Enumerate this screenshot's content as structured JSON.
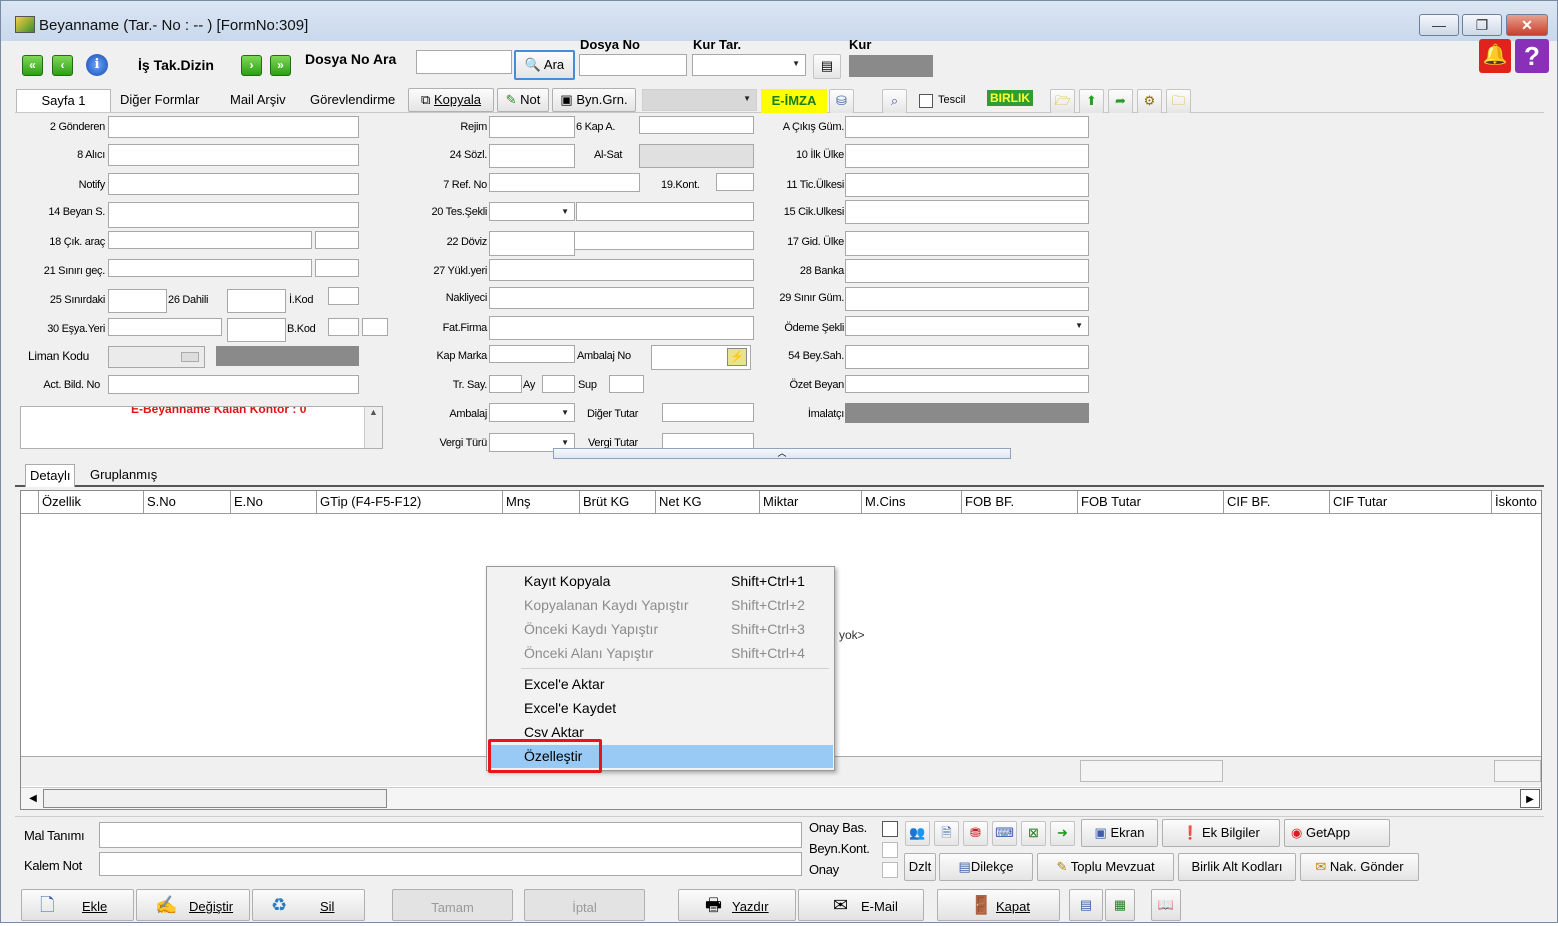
{
  "window": {
    "title": "Beyanname (Tar.- No : --  )  [FormNo:309]",
    "minimize": "—",
    "restore": "❐",
    "close": "✕"
  },
  "toolbar": {
    "first": "«",
    "prev": "‹",
    "info": "i",
    "next": "›",
    "last": "»",
    "task_dir": "İş Tak.Dizin",
    "file_search_label": "Dosya No Ara",
    "search_button": "Ara",
    "file_no_label": "Dosya No",
    "rate_date_label": "Kur Tar.",
    "rate_label": "Kur",
    "bell_icon": "bell-icon",
    "help_icon": "?"
  },
  "tabs": {
    "page1": "Sayfa 1",
    "other_forms": "Diğer Formlar",
    "mail_archive": "Mail Arşiv",
    "assignment": "Görevlendirme",
    "copy": "Kopyala",
    "note": "Not",
    "byn": "Byn.Grn.",
    "eimza": "E-İMZA",
    "tescil": "Tescil",
    "birlik": "BIRLIK"
  },
  "fields": {
    "col1": [
      "2 Gönderen",
      "8 Alıcı",
      "Notify",
      "14 Beyan S.",
      "18 Çık. araç",
      "21 Sınırı geç.",
      "25 Sınırdaki",
      "26 Dahili",
      "İ.Kod",
      "30 Eşya.Yeri",
      "B.Kod",
      "Liman Kodu",
      "Act. Bild. No"
    ],
    "col2": [
      "Rejim",
      "6 Kap A.",
      "24 Sözl.",
      "Al-Sat",
      "7 Ref. No",
      "19.Kont.",
      "20 Tes.Şekli",
      "22 Döviz",
      "27 Yükl.yeri",
      "Nakliyeci",
      "Fat.Firma",
      "Kap Marka",
      "Ambalaj No",
      "Tr. Say.",
      "Ay",
      "Sup",
      "Ambalaj",
      "Diğer Tutar",
      "Vergi Türü",
      "Vergi Tutar"
    ],
    "col3": [
      "A Çıkış Güm.",
      "10 İlk Ülke",
      "11 Tic.Ülkesi",
      "15 Cik.Ulkesi",
      "17 Gid. Ülke",
      "28 Banka",
      "29 Sınır Güm.",
      "Ödeme Şekli",
      "54 Bey.Sah.",
      "Özet Beyan",
      "İmalatçı"
    ],
    "warning_text": "E-Beyanname Kalan Kontör : 0"
  },
  "grid": {
    "tabs": [
      "Detaylı",
      "Gruplanmış"
    ],
    "columns": [
      "Özellik",
      "S.No",
      "E.No",
      "GTip (F4-F5-F12)",
      "Mnş",
      "Brüt KG",
      "Net KG",
      "Miktar",
      "M.Cins",
      "FOB BF.",
      "FOB Tutar",
      "CIF BF.",
      "CIF Tutar",
      "İskonto"
    ],
    "empty_text": "yok>"
  },
  "context_menu": {
    "items": [
      {
        "label": "Kayıt Kopyala",
        "shortcut": "Shift+Ctrl+1"
      },
      {
        "label": "Kopyalanan Kaydı Yapıştır",
        "shortcut": "Shift+Ctrl+2"
      },
      {
        "label": "Önceki Kaydı Yapıştır",
        "shortcut": "Shift+Ctrl+3"
      },
      {
        "label": "Önceki Alanı Yapıştır",
        "shortcut": "Shift+Ctrl+4"
      },
      {
        "label": "Excel'e Aktar",
        "shortcut": ""
      },
      {
        "label": "Excel'e Kaydet",
        "shortcut": ""
      },
      {
        "label": "Csv Aktar",
        "shortcut": ""
      },
      {
        "label": "Özelleştir",
        "shortcut": ""
      }
    ],
    "highlight_color": "#99c9f5",
    "marker_color": "#e8141c"
  },
  "bottom": {
    "goods_desc": "Mal Tanımı",
    "item_note": "Kalem Not",
    "onay_bas": "Onay Bas.",
    "beyn_kont": "Beyn.Kont.",
    "onay": "Onay",
    "ekran": "Ekran",
    "ek_bilgiler": "Ek Bilgiler",
    "getapp": "GetApp",
    "dzlt": "Dzlt",
    "dilekce": "Dilekçe",
    "toplu_mevzuat": "Toplu Mevzuat",
    "birlik_alt": "Birlik Alt Kodları",
    "nak_gonder": "Nak. Gönder",
    "ekle": "Ekle",
    "degistir": "Değiştir",
    "sil": "Sil",
    "tamam": "Tamam",
    "iptal": "İptal",
    "yazdir": "Yazdır",
    "email": "E-Mail",
    "kapat": "Kapat"
  }
}
